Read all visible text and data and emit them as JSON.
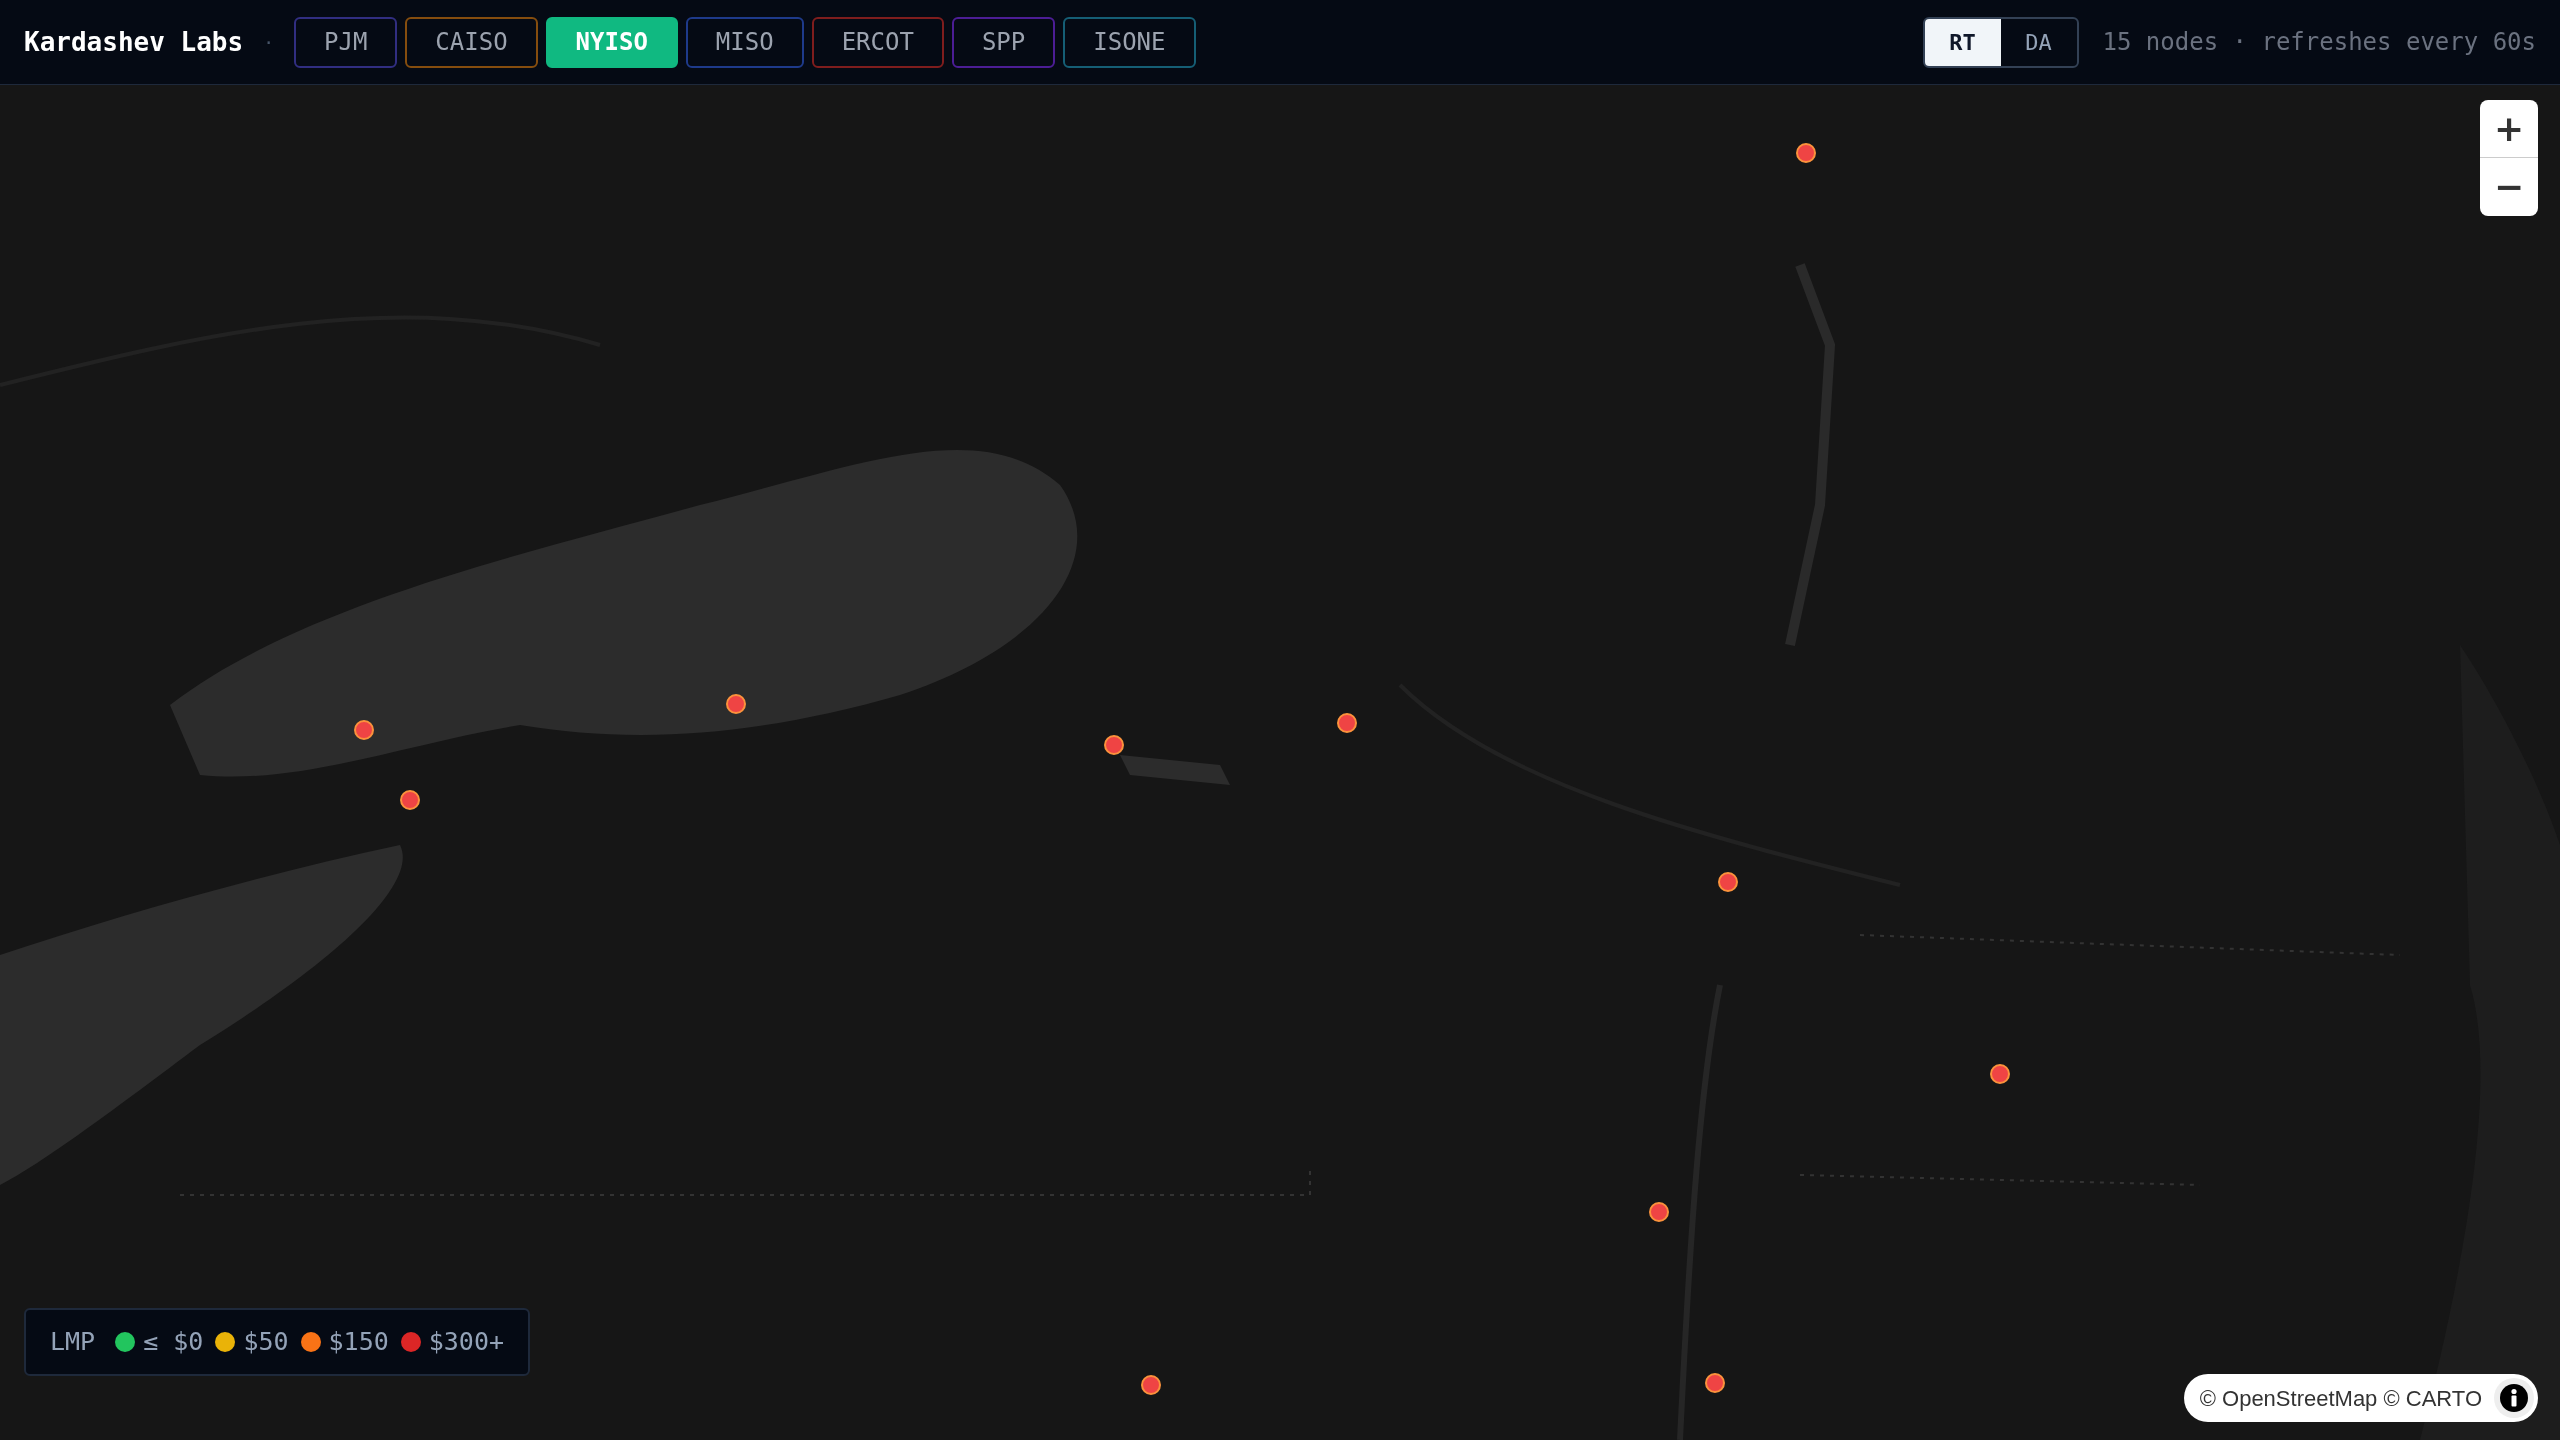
{
  "header": {
    "title": "Kardashev Labs",
    "separator": "·",
    "tabs": [
      {
        "label": "PJM",
        "selected": false,
        "color": "#312e81"
      },
      {
        "label": "CAISO",
        "selected": false,
        "color": "#854d0e"
      },
      {
        "label": "NYISO",
        "selected": true,
        "color": "#10b981"
      },
      {
        "label": "MISO",
        "selected": false,
        "color": "#1e3a8a"
      },
      {
        "label": "ERCOT",
        "selected": false,
        "color": "#7f1d1d"
      },
      {
        "label": "SPP",
        "selected": false,
        "color": "#4c1d95"
      },
      {
        "label": "ISONE",
        "selected": false,
        "color": "#155e75"
      }
    ],
    "market_toggle": [
      {
        "label": "RT",
        "selected": true
      },
      {
        "label": "DA",
        "selected": false
      }
    ],
    "status": "15 nodes · refreshes every 60s"
  },
  "map": {
    "zoom_in": "+",
    "zoom_out": "−",
    "markers": [
      {
        "color": "#ef4444"
      },
      {
        "color": "#ef4444"
      },
      {
        "color": "#ef4444"
      },
      {
        "color": "#ef4444"
      },
      {
        "color": "#ef4444"
      },
      {
        "color": "#ef4444"
      },
      {
        "color": "#ef4444"
      },
      {
        "color": "#ef4444"
      },
      {
        "color": "#ef4444"
      },
      {
        "color": "#ef4444"
      },
      {
        "color": "#ef4444"
      }
    ],
    "attribution": "© OpenStreetMap © CARTO"
  },
  "legend": {
    "title": "LMP",
    "items": [
      {
        "label": "≤ $0",
        "color": "#22c55e"
      },
      {
        "label": "$50",
        "color": "#eab308"
      },
      {
        "label": "$150",
        "color": "#f97316"
      },
      {
        "label": "$300+",
        "color": "#dc2626"
      }
    ]
  }
}
